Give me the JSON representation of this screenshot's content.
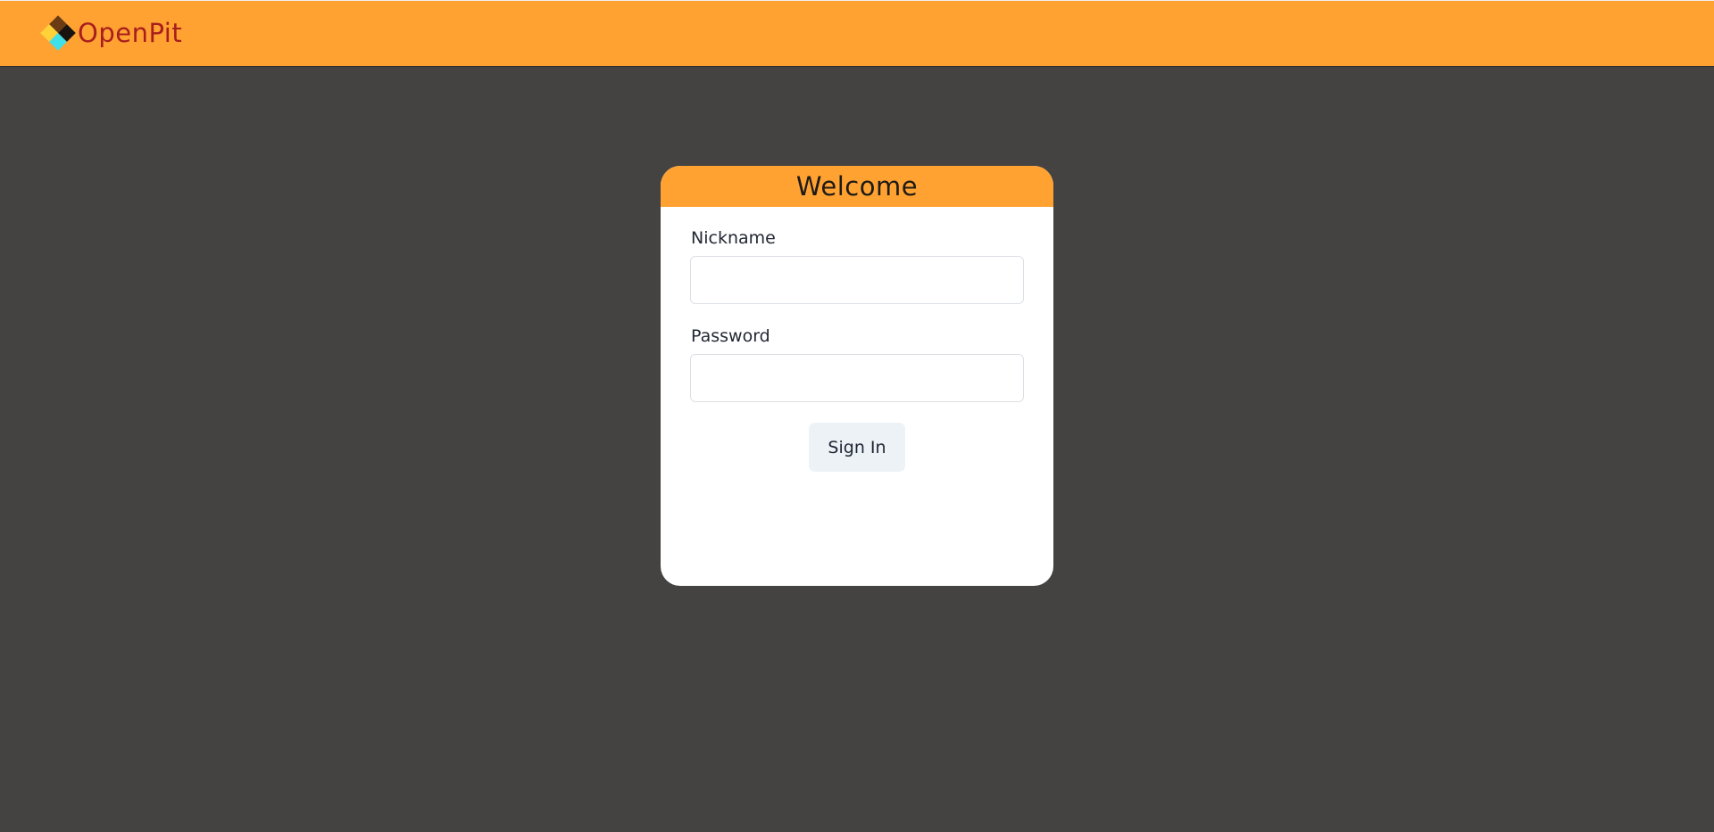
{
  "app": {
    "brand": "OpenPit",
    "colors": {
      "accent": "#ffa232",
      "brand_text": "#a81e1e",
      "background": "#454341"
    },
    "logo_icon": "diamond-logo-icon"
  },
  "login": {
    "title": "Welcome",
    "nickname_label": "Nickname",
    "nickname_value": "",
    "password_label": "Password",
    "password_value": "",
    "submit_label": "Sign In"
  }
}
